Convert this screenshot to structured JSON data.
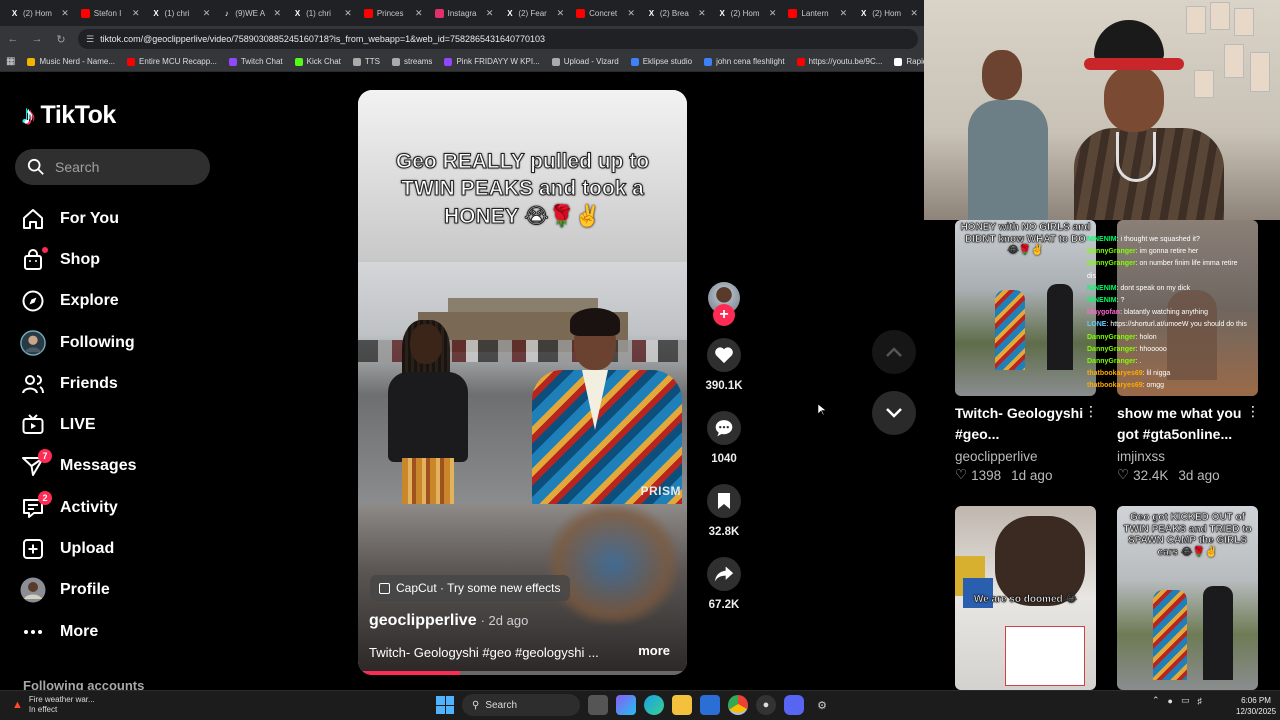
{
  "browser": {
    "tabs": [
      {
        "label": "(2) Hom",
        "icon": "x-icon",
        "color": "#ffffff"
      },
      {
        "label": "Stefon I",
        "icon": "youtube-icon",
        "color": "#ff0000"
      },
      {
        "label": "(1) chri",
        "icon": "x-icon",
        "color": "#ffffff"
      },
      {
        "label": "(9)WE A",
        "icon": "tiktok-icon",
        "color": "#ffffff"
      },
      {
        "label": "(1) chri",
        "icon": "x-icon",
        "color": "#ffffff"
      },
      {
        "label": "Princes",
        "icon": "youtube-icon",
        "color": "#ff0000"
      },
      {
        "label": "Instagra",
        "icon": "instagram-icon",
        "color": "#e1306c"
      },
      {
        "label": "(2) Fear",
        "icon": "x-icon",
        "color": "#ffffff"
      },
      {
        "label": "Concret",
        "icon": "youtube-icon",
        "color": "#ff0000"
      },
      {
        "label": "(2) Brea",
        "icon": "x-icon",
        "color": "#ffffff"
      },
      {
        "label": "(2) Hom",
        "icon": "x-icon",
        "color": "#ffffff"
      },
      {
        "label": "Lantern",
        "icon": "youtube-icon",
        "color": "#ff0000"
      },
      {
        "label": "(2) Hom",
        "icon": "x-icon",
        "color": "#ffffff"
      }
    ],
    "url": "tiktok.com/@geoclipperlive/video/7589030885245160718?is_from_webapp=1&web_id=7582865431640770103",
    "bookmarks": [
      {
        "label": "Music Nerd - Name...",
        "color": "#f4b400"
      },
      {
        "label": "Entire MCU Recapp...",
        "color": "#ff0000"
      },
      {
        "label": "Twitch Chat",
        "color": "#9146ff"
      },
      {
        "label": "Kick Chat",
        "color": "#53fc18"
      },
      {
        "label": "TTS",
        "color": "#aaaaaa"
      },
      {
        "label": "streams",
        "color": "#aaaaaa"
      },
      {
        "label": "Pink FRIDAYY W KPI...",
        "color": "#9146ff"
      },
      {
        "label": "Upload - Vizard",
        "color": "#aaaaaa"
      },
      {
        "label": "Eklipse studio",
        "color": "#3b82f6"
      },
      {
        "label": "john cena fleshlight",
        "color": "#3b82f6"
      },
      {
        "label": "https://youtu.be/9C...",
        "color": "#ff0000"
      },
      {
        "label": "Rapidtags | You",
        "color": "#ffffff"
      }
    ]
  },
  "tiktok": {
    "logo": "TikTok",
    "search_placeholder": "Search",
    "nav": [
      {
        "label": "For You",
        "icon": "home-icon"
      },
      {
        "label": "Shop",
        "icon": "shop-bag-icon",
        "dot": true
      },
      {
        "label": "Explore",
        "icon": "compass-icon"
      },
      {
        "label": "Following",
        "icon": "following-avatar-icon"
      },
      {
        "label": "Friends",
        "icon": "friends-icon"
      },
      {
        "label": "LIVE",
        "icon": "live-tv-icon"
      },
      {
        "label": "Messages",
        "icon": "send-icon",
        "badge": "7"
      },
      {
        "label": "Activity",
        "icon": "inbox-icon",
        "badge": "2"
      },
      {
        "label": "Upload",
        "icon": "plus-square-icon"
      },
      {
        "label": "Profile",
        "icon": "profile-avatar-icon"
      },
      {
        "label": "More",
        "icon": "more-dots-icon"
      }
    ],
    "following_accounts": "Following accounts"
  },
  "video": {
    "caption": "Geo REALLY pulled up to TWIN PEAKS and took a HONEY 😭🌹✌️",
    "watermark": "PRISM",
    "effect_label": "CapCut · Try some new effects",
    "author": "geoclipperlive",
    "posted": "· 2d ago",
    "description": "Twitch- Geologyshi #geo #geologyshi ...",
    "more": "more",
    "progress": 0.31,
    "likes": "390.1K",
    "comments": "1040",
    "saves": "32.8K",
    "shares": "67.2K"
  },
  "recommended": [
    {
      "title": "Twitch- Geologyshi #geo...",
      "author": "geoclipperlive",
      "likes": "1398",
      "age": "1d ago",
      "overlay": "HONEY with NO GIRLS and DIDNT know WHAT to DO 😂🌹✌️"
    },
    {
      "title": "show me what you got #gta5online...",
      "author": "imjinxss",
      "likes": "32.4K",
      "age": "3d ago",
      "overlay": ""
    },
    {
      "overlay": "We are so doomed 😂"
    },
    {
      "overlay": "Geo got KICKED OUT of TWIN PEAKS and TRIED to SPAWN CAMP the GIRLS cars 😂🌹✌️"
    }
  ],
  "chat": [
    {
      "user": "NINENIM",
      "msg": ": i thought we squashed it?",
      "color": "#00ff66"
    },
    {
      "user": "DannyGranger",
      "msg": ": im gonna retire her",
      "color": "#7fff00"
    },
    {
      "user": "DannyGranger",
      "msg": ": on number finim life imma retire dis",
      "color": "#7fff00"
    },
    {
      "user": "NINENIM",
      "msg": ": dont speak on my dick",
      "color": "#00ff66"
    },
    {
      "user": "NINENIM",
      "msg": ": ?",
      "color": "#00ff66"
    },
    {
      "user": "lifaygofan",
      "msg": ": blatantly watching anything",
      "color": "#ff66cc"
    },
    {
      "user": "LONE",
      "msg": ": https://shorturl.at/umoeW you should do this",
      "color": "#66ccff"
    },
    {
      "user": "DannyGranger",
      "msg": ": holon",
      "color": "#7fff00"
    },
    {
      "user": "DannyGranger",
      "msg": ": hhooooo",
      "color": "#7fff00"
    },
    {
      "user": "DannyGranger",
      "msg": ": .",
      "color": "#7fff00"
    },
    {
      "user": "thatbookaryes69",
      "msg": ": lil nigga",
      "color": "#ffaa00"
    },
    {
      "user": "thatbookaryes69",
      "msg": ": omgg",
      "color": "#ffaa00"
    }
  ],
  "taskbar": {
    "weather_line1": "Fire weather war...",
    "weather_line2": "In effect",
    "search": "Search",
    "time": "6:06 PM",
    "date": "12/30/2025"
  }
}
